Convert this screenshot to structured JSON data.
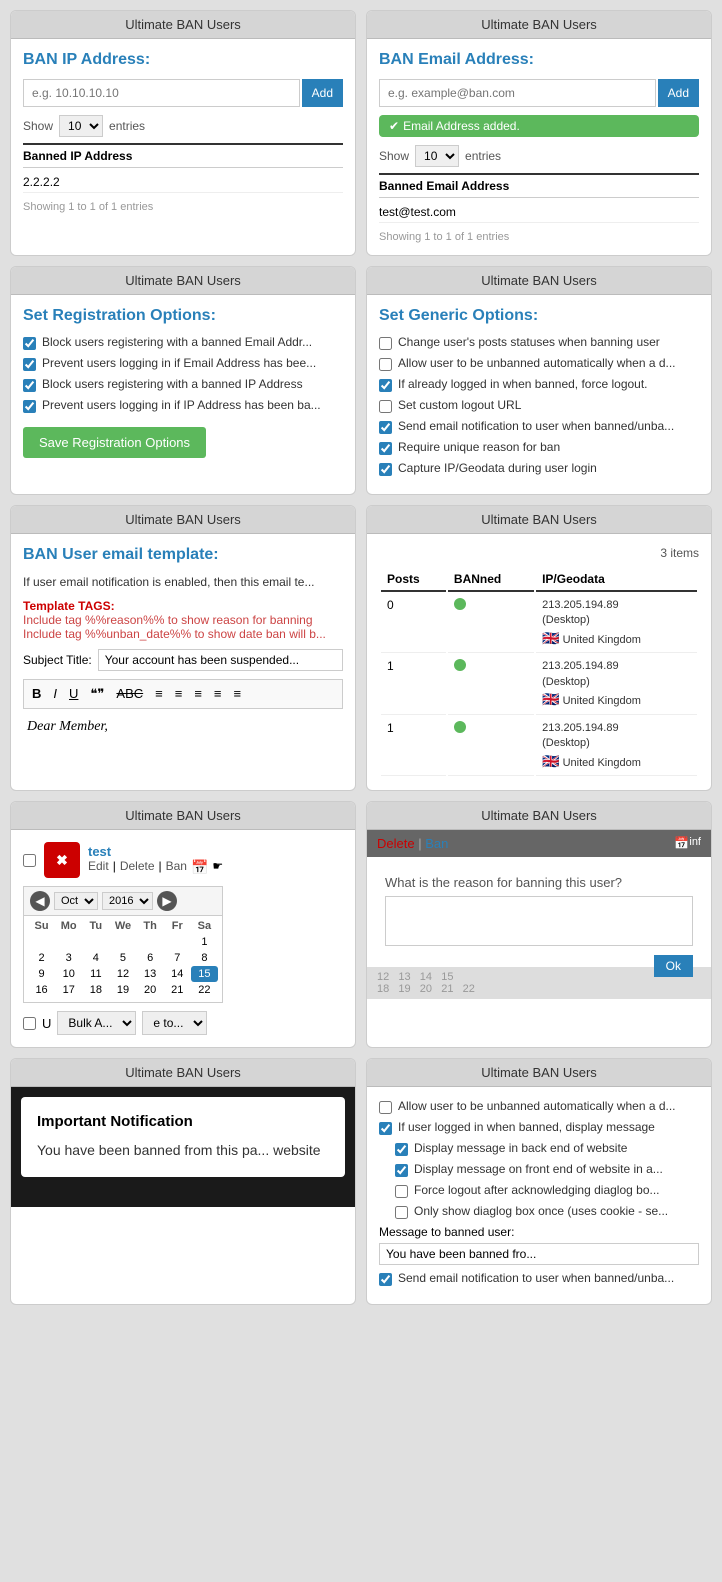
{
  "panels": {
    "ban_ip": {
      "header": "Ultimate BAN Users",
      "title": "BAN IP Address:",
      "input_placeholder": "e.g. 10.10.10.10",
      "add_label": "Add",
      "show_label": "Show",
      "show_value": "10",
      "entries_label": "entries",
      "table_header": "Banned IP Address",
      "table_row": "2.2.2.2",
      "showing": "Showing 1 to 1 of 1 entries"
    },
    "ban_email": {
      "header": "Ultimate BAN Users",
      "title": "BAN Email Address:",
      "input_placeholder": "e.g. example@ban.com",
      "add_label": "Add",
      "success_msg": "Email Address added.",
      "show_label": "Show",
      "show_value": "10",
      "entries_label": "entries",
      "table_header": "Banned Email Address",
      "table_row": "test@test.com",
      "showing": "Showing 1 to 1 of 1 entries"
    },
    "registration_options": {
      "header": "Ultimate BAN Users",
      "title": "Set Registration Options:",
      "options": [
        "Block users registering with a banned Email Addr...",
        "Prevent users logging in if Email Address has bee...",
        "Block users registering with a banned IP Address",
        "Prevent users logging in if IP Address has been ba..."
      ],
      "save_label": "Save Registration Options"
    },
    "generic_options": {
      "header": "Ultimate BAN Users",
      "title": "Set Generic Options:",
      "options": [
        {
          "label": "Change user's posts statuses when banning user",
          "checked": false
        },
        {
          "label": "Allow user to be unbanned automatically when a d...",
          "checked": false
        },
        {
          "label": "If already logged in when banned, force logout.",
          "checked": true
        },
        {
          "label": "Set custom logout URL",
          "checked": false
        },
        {
          "label": "Send email notification to user when banned/unba...",
          "checked": true
        },
        {
          "label": "Require unique reason for ban",
          "checked": true
        },
        {
          "label": "Capture IP/Geodata during user login",
          "checked": true
        }
      ]
    },
    "email_template": {
      "header": "Ultimate BAN Users",
      "title": "BAN User email template:",
      "intro": "If user email notification is enabled, then this email te...",
      "template_tags_label": "Template TAGS:",
      "tag1_desc": "Include tag %%reason%% to show reason for banning",
      "tag2_desc": "Include tag %%unban_date%% to show date ban will b...",
      "subject_label": "Subject Title:",
      "subject_value": "Your account has been suspended...",
      "toolbar_buttons": [
        "B",
        "I",
        "U",
        "\"\"",
        "ABC",
        "≡",
        "≡",
        "≡",
        "≡",
        "≡"
      ],
      "editor_content": "Dear Member,"
    },
    "user_list": {
      "header": "Ultimate BAN Users",
      "items_count": "3 items",
      "columns": [
        "Posts",
        "BANned",
        "IP/Geodata"
      ],
      "rows": [
        {
          "posts": "0",
          "banned": true,
          "ip": "213.205.194.89",
          "device": "(Desktop)",
          "country": "United Kingdom"
        },
        {
          "posts": "1",
          "banned": true,
          "ip": "213.205.194.89",
          "device": "(Desktop)",
          "country": "United Kingdom"
        },
        {
          "posts": "1",
          "banned": true,
          "ip": "213.205.194.89",
          "device": "(Desktop)",
          "country": "United Kingdom"
        }
      ]
    },
    "user_edit": {
      "header": "Ultimate BAN Users",
      "user_name": "test",
      "edit_label": "Edit",
      "delete_label": "Delete",
      "ban_label": "Ban",
      "calendar_month": "Oct",
      "calendar_year": "2016",
      "days_header": [
        "Su",
        "Mo",
        "Tu",
        "We",
        "Th",
        "Fr",
        "Sa"
      ],
      "weeks": [
        [
          "",
          "",
          "",
          "",
          "",
          "",
          "1"
        ],
        [
          "2",
          "3",
          "4",
          "5",
          "6",
          "7",
          "8"
        ],
        [
          "9",
          "10",
          "11",
          "12",
          "13",
          "14",
          "15"
        ],
        [
          "16",
          "17",
          "18",
          "19",
          "20",
          "21",
          "22"
        ]
      ],
      "bulk_action_placeholder": "Bulk A...",
      "apply_label": "e to...",
      "checkbox_label": "U"
    },
    "ban_reason": {
      "header": "Ultimate BAN Users",
      "delete_label": "Delete",
      "ban_label": "Ban",
      "reason_label": "What is the reason for banning this user?",
      "ok_label": "Ok",
      "info_label": "inf",
      "calendar_rows": [
        [
          "",
          "",
          "",
          "",
          "",
          "12",
          "13",
          "14",
          "15"
        ],
        [
          "18",
          "19",
          "20",
          "21",
          "22"
        ]
      ]
    },
    "important_notification": {
      "header": "Ultimate BAN Users",
      "title": "Important Notification",
      "message": "You have been banned from this pa... website"
    },
    "display_options": {
      "header": "Ultimate BAN Users",
      "options": [
        {
          "label": "Allow user to be unbanned automatically when a d...",
          "checked": false
        },
        {
          "label": "If user logged in when banned, display message",
          "checked": true
        },
        {
          "label": "Display message in back end of website",
          "checked": true,
          "sub": true
        },
        {
          "label": "Display message on front end of website in a...",
          "checked": true,
          "sub": true
        },
        {
          "label": "Force logout after acknowledging diaglog bo...",
          "checked": false,
          "sub": true
        },
        {
          "label": "Only show diaglog box once (uses cookie - se...",
          "checked": false,
          "sub": true
        }
      ],
      "message_label": "Message to banned user:",
      "message_value": "You have been banned fro...",
      "last_option": {
        "label": "Send email notification to user when banned/unba...",
        "checked": true
      }
    }
  }
}
